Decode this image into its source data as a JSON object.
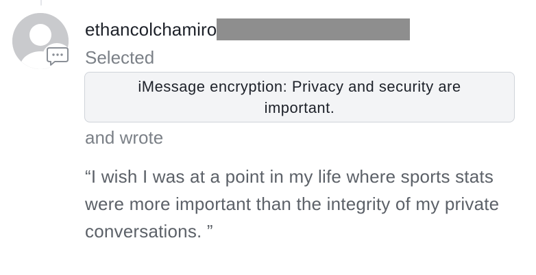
{
  "comment": {
    "username": "ethancolchamiro",
    "action_selected": "Selected",
    "selected_text": "iMessage encryption: Privacy and security are important.",
    "action_wrote": "and wrote",
    "quote": "“I wish I was at a point in my life where sports stats were more important than the integrity of my private conversations. ”"
  },
  "icons": {
    "avatar": "default-user-avatar",
    "badge": "comment-bubble-icon"
  },
  "colors": {
    "text_primary": "#1d2129",
    "text_secondary": "#7b8087",
    "quote_text": "#5c6168",
    "selection_bg": "#f3f4f6",
    "selection_border": "#cfd3d9",
    "redaction": "#8e8e8e"
  }
}
